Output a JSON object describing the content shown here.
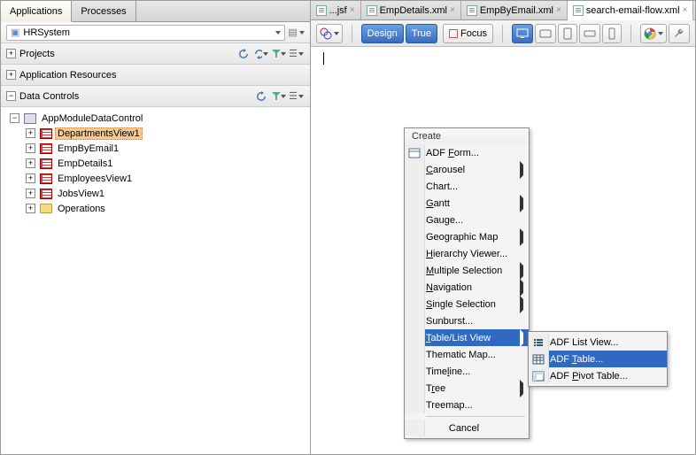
{
  "left": {
    "tabs": [
      "Applications",
      "Processes"
    ],
    "active_tab": 0,
    "project_combo": "HRSystem",
    "sections": {
      "projects": "Projects",
      "resources": "Application Resources",
      "controls": "Data Controls"
    },
    "tree": {
      "root": "AppModuleDataControl",
      "children": [
        {
          "label": "DepartmentsView1",
          "selected": true,
          "type": "vo"
        },
        {
          "label": "EmpByEmail1",
          "selected": false,
          "type": "vo"
        },
        {
          "label": "EmpDetails1",
          "selected": false,
          "type": "vo"
        },
        {
          "label": "EmployeesView1",
          "selected": false,
          "type": "vo"
        },
        {
          "label": "JobsView1",
          "selected": false,
          "type": "vo"
        },
        {
          "label": "Operations",
          "selected": false,
          "type": "folder"
        }
      ]
    }
  },
  "editor": {
    "tabs": [
      {
        "label": "...jsf",
        "active": false
      },
      {
        "label": "EmpDetails.xml",
        "active": false
      },
      {
        "label": "EmpByEmail.xml",
        "active": false
      },
      {
        "label": "search-email-flow.xml",
        "active": true
      }
    ],
    "toolbar": {
      "design": "Design",
      "true_btn": "True",
      "focus": "Focus"
    }
  },
  "context_menu": {
    "title": "Create",
    "items": [
      {
        "label": "ADF Form...",
        "icon": "form",
        "u": 4
      },
      {
        "label": "Carousel",
        "sub": true,
        "u": 0
      },
      {
        "label": "Chart...",
        "u": -1
      },
      {
        "label": "Gantt",
        "sub": true,
        "u": 0
      },
      {
        "label": "Gauge...",
        "u": 3
      },
      {
        "label": "Geographic Map",
        "sub": true,
        "u": -1
      },
      {
        "label": "Hierarchy Viewer...",
        "u": 0
      },
      {
        "label": "Multiple Selection",
        "sub": true,
        "u": 0
      },
      {
        "label": "Navigation",
        "sub": true,
        "u": 0
      },
      {
        "label": "Single Selection",
        "sub": true,
        "u": 0
      },
      {
        "label": "Sunburst...",
        "u": -1
      },
      {
        "label": "Table/List View",
        "sub": true,
        "u": 0,
        "selected": true
      },
      {
        "label": "Thematic Map...",
        "u": -1
      },
      {
        "label": "Timeline...",
        "u": 4
      },
      {
        "label": "Tree",
        "sub": true,
        "u": 1
      },
      {
        "label": "Treemap...",
        "u": -1
      }
    ],
    "cancel": "Cancel"
  },
  "submenu": {
    "items": [
      {
        "label": "ADF List View...",
        "icon": "list"
      },
      {
        "label": "ADF Table...",
        "icon": "table",
        "u": 4,
        "selected": true
      },
      {
        "label": "ADF Pivot Table...",
        "icon": "pivot",
        "u": 4
      }
    ]
  }
}
